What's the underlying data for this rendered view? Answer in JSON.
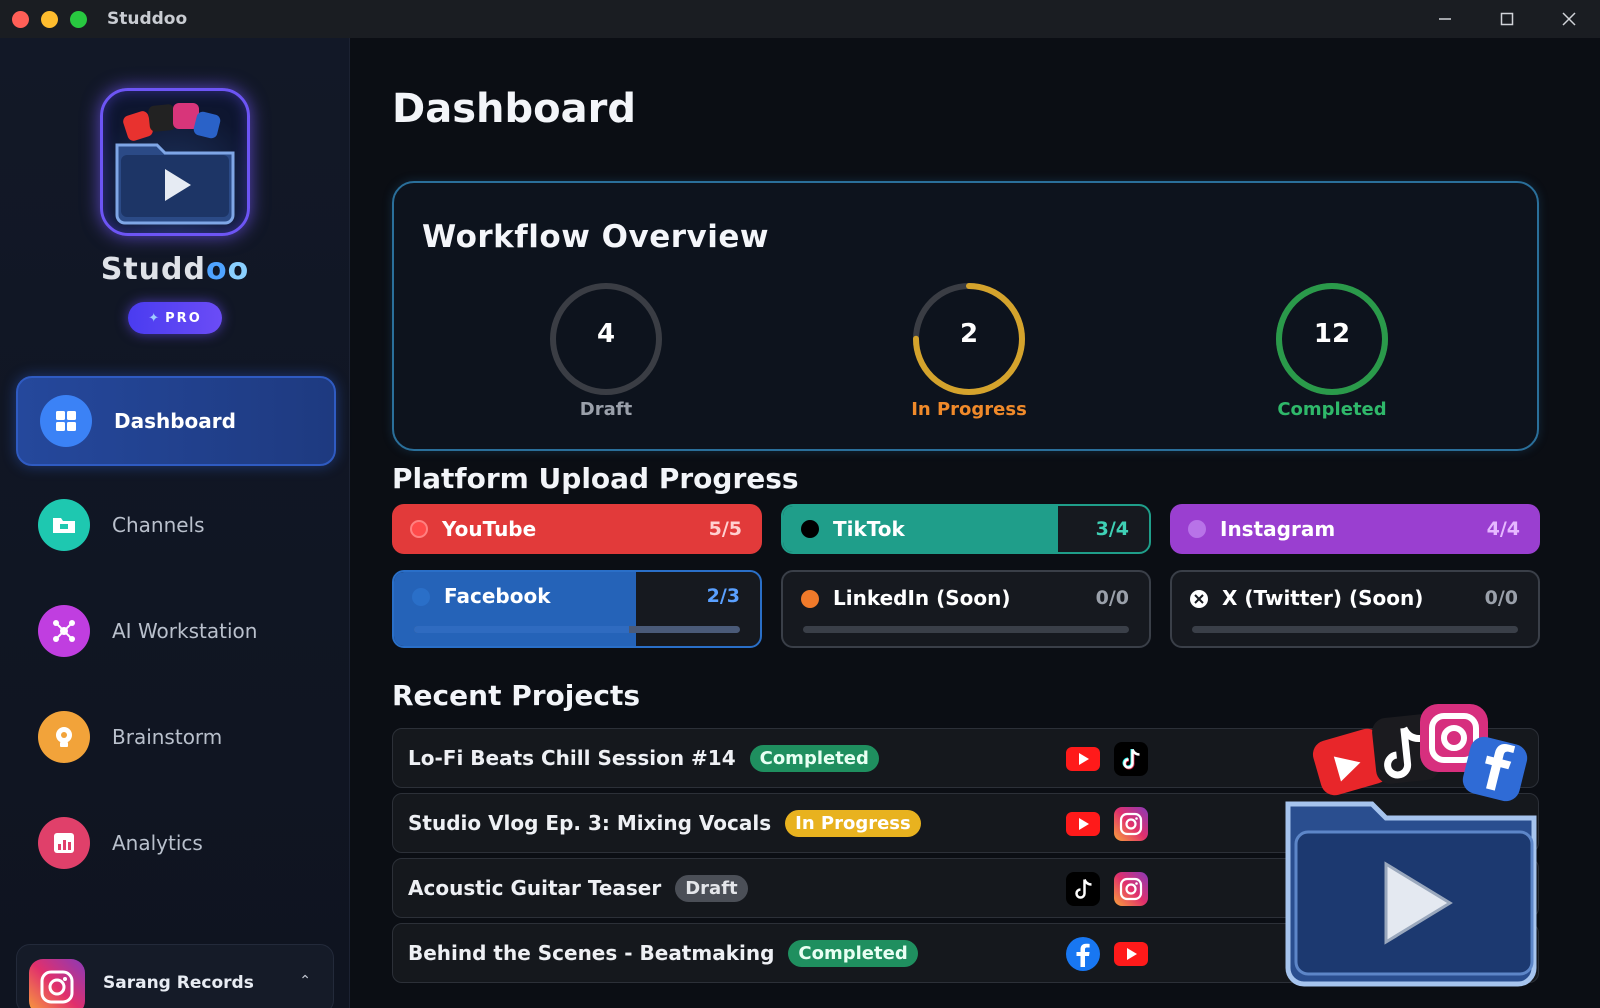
{
  "window": {
    "title": "Studdoo",
    "minimize": "—",
    "maximize": "☐",
    "close": "✕"
  },
  "sidebar": {
    "brand_part1": "Studd",
    "brand_o1": "o",
    "brand_o2": "o",
    "badge": "PRO",
    "items": [
      {
        "label": "Dashboard",
        "icon": "dashboard-grid-icon",
        "color": "#3b82f6",
        "active": true
      },
      {
        "label": "Channels",
        "icon": "folder-icon",
        "color": "#1ec8b0",
        "active": false
      },
      {
        "label": "AI Workstation",
        "icon": "network-icon",
        "color": "#c03ee0",
        "active": false
      },
      {
        "label": "Brainstorm",
        "icon": "lightbulb-icon",
        "color": "#f2a33a",
        "active": false
      },
      {
        "label": "Analytics",
        "icon": "bar-chart-icon",
        "color": "#e0406a",
        "active": false
      }
    ],
    "account": {
      "name": "Sarang Records",
      "chevron": "⌃"
    }
  },
  "main": {
    "title": "Dashboard",
    "overview": {
      "title": "Workflow Overview",
      "stats": [
        {
          "value": "4",
          "label": "Draft",
          "color": "#9aa0aa",
          "ring_color": "#3a3d44",
          "progress": 0
        },
        {
          "value": "2",
          "label": "In Progress",
          "color": "#f08a2a",
          "ring_color": "#d4a32c",
          "progress": 0.75
        },
        {
          "value": "12",
          "label": "Completed",
          "color": "#2fb86a",
          "ring_color": "#2a9a4a",
          "progress": 1.0
        }
      ]
    },
    "platform_section_title": "Platform Upload Progress",
    "platforms": [
      {
        "name": "YouTube",
        "count": "5/5",
        "progress": 1.0,
        "color": "#e23a3a"
      },
      {
        "name": "TikTok",
        "count": "3/4",
        "progress": 0.75,
        "color": "#1f9e8a"
      },
      {
        "name": "Instagram",
        "count": "4/4",
        "progress": 1.0,
        "color": "#9a3fd0"
      },
      {
        "name": "Facebook",
        "count": "2/3",
        "progress": 0.66,
        "color": "#2563b8"
      },
      {
        "name": "LinkedIn (Soon)",
        "count": "0/0",
        "progress": 0,
        "color": "#f07a2a"
      },
      {
        "name": "X (Twitter) (Soon)",
        "count": "0/0",
        "progress": 0,
        "color": "#ffffff"
      }
    ],
    "recent_section_title": "Recent Projects",
    "projects": [
      {
        "title": "Lo-Fi Beats Chill Session #14",
        "status": "Completed",
        "platforms": [
          "youtube-icon",
          "tiktok-icon"
        ]
      },
      {
        "title": "Studio Vlog Ep. 3: Mixing Vocals",
        "status": "In Progress",
        "platforms": [
          "youtube-icon",
          "instagram-icon"
        ]
      },
      {
        "title": "Acoustic Guitar Teaser",
        "status": "Draft",
        "platforms": [
          "tiktok-icon",
          "instagram-icon"
        ]
      },
      {
        "title": "Behind the Scenes - Beatmaking",
        "status": "Completed",
        "platforms": [
          "facebook-icon",
          "youtube-icon"
        ]
      }
    ]
  }
}
